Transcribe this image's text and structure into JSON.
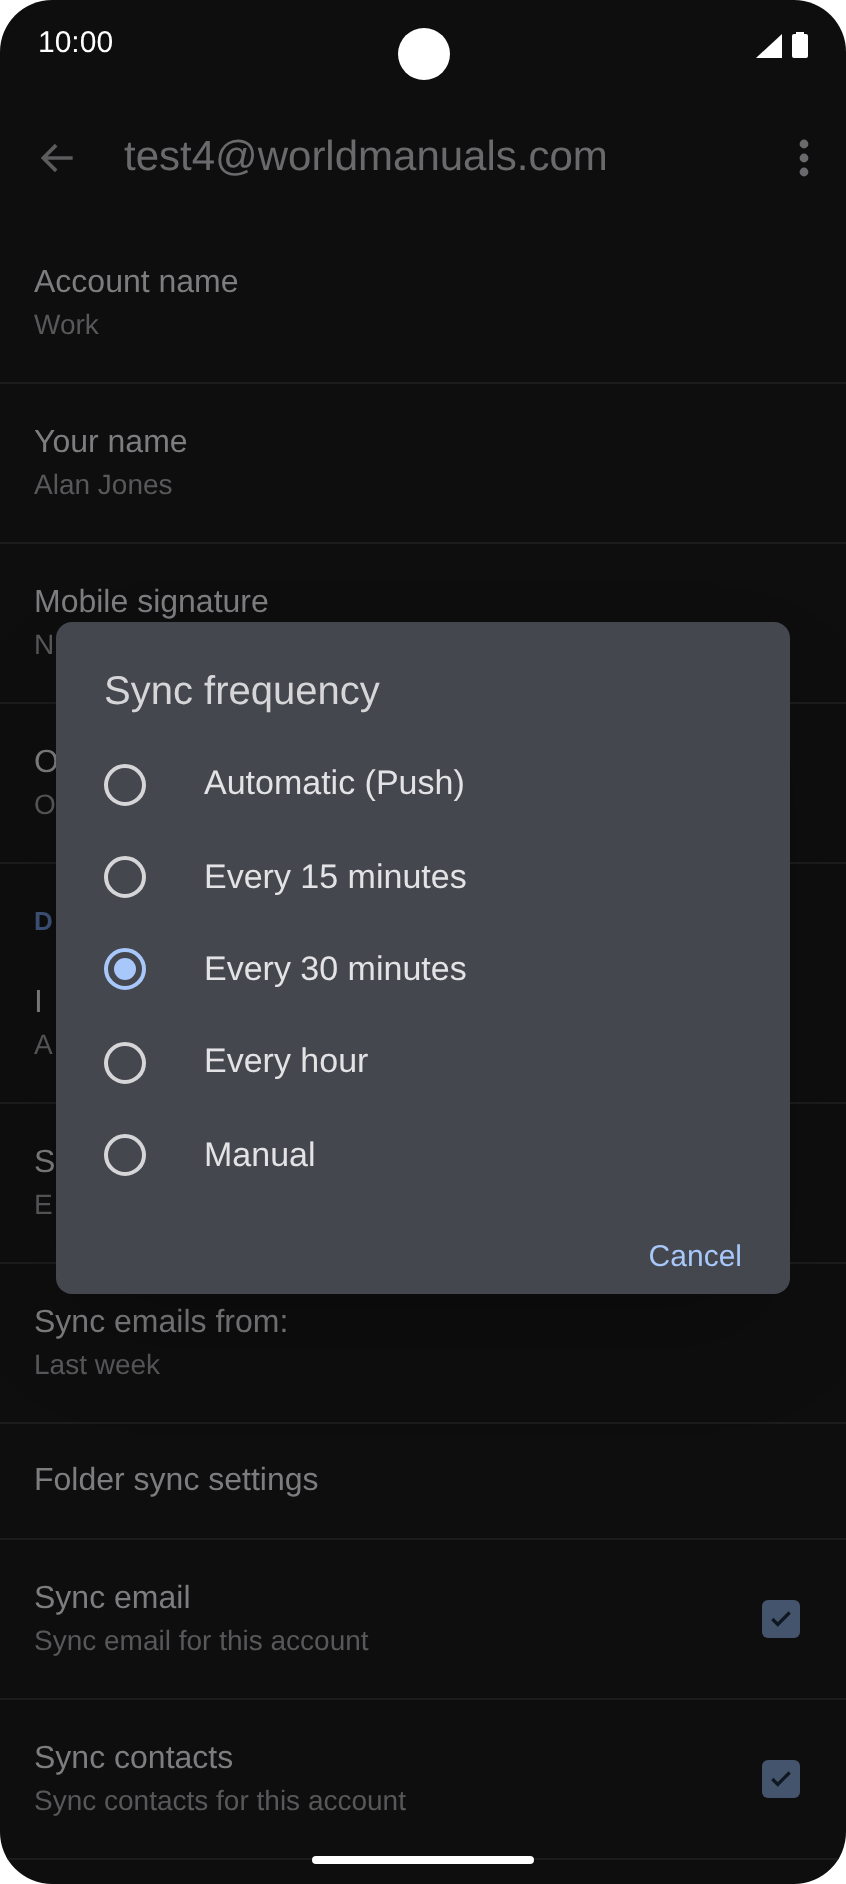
{
  "status_bar": {
    "time": "10:00"
  },
  "header": {
    "title": "test4@worldmanuals.com"
  },
  "settings": [
    {
      "kind": "item",
      "title": "Account name",
      "subtitle": "Work"
    },
    {
      "kind": "item",
      "title": "Your name",
      "subtitle": "Alan Jones"
    },
    {
      "kind": "item",
      "title": "Mobile signature",
      "subtitle": "N"
    },
    {
      "kind": "item",
      "title": "O",
      "subtitle": "O"
    },
    {
      "kind": "section",
      "title": "D"
    },
    {
      "kind": "item",
      "title": "I",
      "subtitle": "A"
    },
    {
      "kind": "item",
      "title": "S",
      "subtitle": "E"
    },
    {
      "kind": "item",
      "title": "Sync emails from:",
      "subtitle": "Last week"
    },
    {
      "kind": "item",
      "title": "Folder sync settings"
    },
    {
      "kind": "check",
      "title": "Sync email",
      "subtitle": "Sync email for this account",
      "checked": true
    },
    {
      "kind": "check",
      "title": "Sync contacts",
      "subtitle": "Sync contacts for this account",
      "checked": true
    }
  ],
  "dialog": {
    "title": "Sync frequency",
    "options": [
      {
        "label": "Automatic (Push)",
        "selected": false
      },
      {
        "label": "Every 15 minutes",
        "selected": false
      },
      {
        "label": "Every 30 minutes",
        "selected": true
      },
      {
        "label": "Every hour",
        "selected": false
      },
      {
        "label": "Manual",
        "selected": false
      }
    ],
    "cancel": "Cancel"
  }
}
